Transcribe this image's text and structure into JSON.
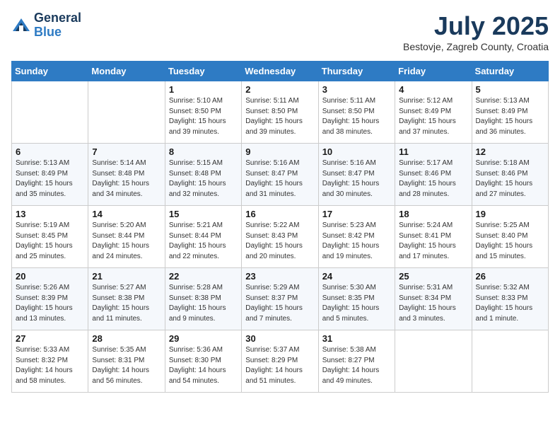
{
  "header": {
    "logo_general": "General",
    "logo_blue": "Blue",
    "month_title": "July 2025",
    "location": "Bestovje, Zagreb County, Croatia"
  },
  "weekdays": [
    "Sunday",
    "Monday",
    "Tuesday",
    "Wednesday",
    "Thursday",
    "Friday",
    "Saturday"
  ],
  "weeks": [
    [
      {
        "day": "",
        "sunrise": "",
        "sunset": "",
        "daylight": ""
      },
      {
        "day": "",
        "sunrise": "",
        "sunset": "",
        "daylight": ""
      },
      {
        "day": "1",
        "sunrise": "Sunrise: 5:10 AM",
        "sunset": "Sunset: 8:50 PM",
        "daylight": "Daylight: 15 hours and 39 minutes."
      },
      {
        "day": "2",
        "sunrise": "Sunrise: 5:11 AM",
        "sunset": "Sunset: 8:50 PM",
        "daylight": "Daylight: 15 hours and 39 minutes."
      },
      {
        "day": "3",
        "sunrise": "Sunrise: 5:11 AM",
        "sunset": "Sunset: 8:50 PM",
        "daylight": "Daylight: 15 hours and 38 minutes."
      },
      {
        "day": "4",
        "sunrise": "Sunrise: 5:12 AM",
        "sunset": "Sunset: 8:49 PM",
        "daylight": "Daylight: 15 hours and 37 minutes."
      },
      {
        "day": "5",
        "sunrise": "Sunrise: 5:13 AM",
        "sunset": "Sunset: 8:49 PM",
        "daylight": "Daylight: 15 hours and 36 minutes."
      }
    ],
    [
      {
        "day": "6",
        "sunrise": "Sunrise: 5:13 AM",
        "sunset": "Sunset: 8:49 PM",
        "daylight": "Daylight: 15 hours and 35 minutes."
      },
      {
        "day": "7",
        "sunrise": "Sunrise: 5:14 AM",
        "sunset": "Sunset: 8:48 PM",
        "daylight": "Daylight: 15 hours and 34 minutes."
      },
      {
        "day": "8",
        "sunrise": "Sunrise: 5:15 AM",
        "sunset": "Sunset: 8:48 PM",
        "daylight": "Daylight: 15 hours and 32 minutes."
      },
      {
        "day": "9",
        "sunrise": "Sunrise: 5:16 AM",
        "sunset": "Sunset: 8:47 PM",
        "daylight": "Daylight: 15 hours and 31 minutes."
      },
      {
        "day": "10",
        "sunrise": "Sunrise: 5:16 AM",
        "sunset": "Sunset: 8:47 PM",
        "daylight": "Daylight: 15 hours and 30 minutes."
      },
      {
        "day": "11",
        "sunrise": "Sunrise: 5:17 AM",
        "sunset": "Sunset: 8:46 PM",
        "daylight": "Daylight: 15 hours and 28 minutes."
      },
      {
        "day": "12",
        "sunrise": "Sunrise: 5:18 AM",
        "sunset": "Sunset: 8:46 PM",
        "daylight": "Daylight: 15 hours and 27 minutes."
      }
    ],
    [
      {
        "day": "13",
        "sunrise": "Sunrise: 5:19 AM",
        "sunset": "Sunset: 8:45 PM",
        "daylight": "Daylight: 15 hours and 25 minutes."
      },
      {
        "day": "14",
        "sunrise": "Sunrise: 5:20 AM",
        "sunset": "Sunset: 8:44 PM",
        "daylight": "Daylight: 15 hours and 24 minutes."
      },
      {
        "day": "15",
        "sunrise": "Sunrise: 5:21 AM",
        "sunset": "Sunset: 8:44 PM",
        "daylight": "Daylight: 15 hours and 22 minutes."
      },
      {
        "day": "16",
        "sunrise": "Sunrise: 5:22 AM",
        "sunset": "Sunset: 8:43 PM",
        "daylight": "Daylight: 15 hours and 20 minutes."
      },
      {
        "day": "17",
        "sunrise": "Sunrise: 5:23 AM",
        "sunset": "Sunset: 8:42 PM",
        "daylight": "Daylight: 15 hours and 19 minutes."
      },
      {
        "day": "18",
        "sunrise": "Sunrise: 5:24 AM",
        "sunset": "Sunset: 8:41 PM",
        "daylight": "Daylight: 15 hours and 17 minutes."
      },
      {
        "day": "19",
        "sunrise": "Sunrise: 5:25 AM",
        "sunset": "Sunset: 8:40 PM",
        "daylight": "Daylight: 15 hours and 15 minutes."
      }
    ],
    [
      {
        "day": "20",
        "sunrise": "Sunrise: 5:26 AM",
        "sunset": "Sunset: 8:39 PM",
        "daylight": "Daylight: 15 hours and 13 minutes."
      },
      {
        "day": "21",
        "sunrise": "Sunrise: 5:27 AM",
        "sunset": "Sunset: 8:38 PM",
        "daylight": "Daylight: 15 hours and 11 minutes."
      },
      {
        "day": "22",
        "sunrise": "Sunrise: 5:28 AM",
        "sunset": "Sunset: 8:38 PM",
        "daylight": "Daylight: 15 hours and 9 minutes."
      },
      {
        "day": "23",
        "sunrise": "Sunrise: 5:29 AM",
        "sunset": "Sunset: 8:37 PM",
        "daylight": "Daylight: 15 hours and 7 minutes."
      },
      {
        "day": "24",
        "sunrise": "Sunrise: 5:30 AM",
        "sunset": "Sunset: 8:35 PM",
        "daylight": "Daylight: 15 hours and 5 minutes."
      },
      {
        "day": "25",
        "sunrise": "Sunrise: 5:31 AM",
        "sunset": "Sunset: 8:34 PM",
        "daylight": "Daylight: 15 hours and 3 minutes."
      },
      {
        "day": "26",
        "sunrise": "Sunrise: 5:32 AM",
        "sunset": "Sunset: 8:33 PM",
        "daylight": "Daylight: 15 hours and 1 minute."
      }
    ],
    [
      {
        "day": "27",
        "sunrise": "Sunrise: 5:33 AM",
        "sunset": "Sunset: 8:32 PM",
        "daylight": "Daylight: 14 hours and 58 minutes."
      },
      {
        "day": "28",
        "sunrise": "Sunrise: 5:35 AM",
        "sunset": "Sunset: 8:31 PM",
        "daylight": "Daylight: 14 hours and 56 minutes."
      },
      {
        "day": "29",
        "sunrise": "Sunrise: 5:36 AM",
        "sunset": "Sunset: 8:30 PM",
        "daylight": "Daylight: 14 hours and 54 minutes."
      },
      {
        "day": "30",
        "sunrise": "Sunrise: 5:37 AM",
        "sunset": "Sunset: 8:29 PM",
        "daylight": "Daylight: 14 hours and 51 minutes."
      },
      {
        "day": "31",
        "sunrise": "Sunrise: 5:38 AM",
        "sunset": "Sunset: 8:27 PM",
        "daylight": "Daylight: 14 hours and 49 minutes."
      },
      {
        "day": "",
        "sunrise": "",
        "sunset": "",
        "daylight": ""
      },
      {
        "day": "",
        "sunrise": "",
        "sunset": "",
        "daylight": ""
      }
    ]
  ]
}
